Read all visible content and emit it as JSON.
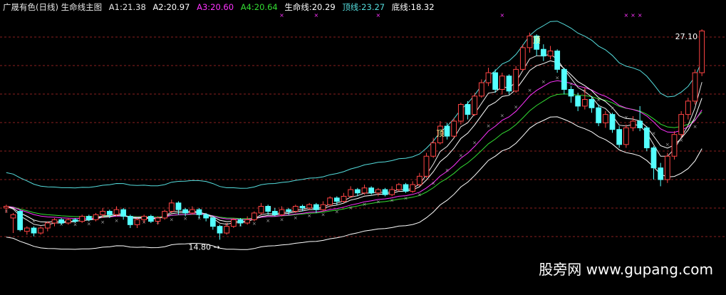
{
  "header": {
    "title": "广晟有色(日线) 生命线主图",
    "items": [
      {
        "label": "A1:21.38",
        "color": "#e6e6e6"
      },
      {
        "label": "A2:20.97",
        "color": "#ffffff"
      },
      {
        "label": "A3:20.60",
        "color": "#ff33ff"
      },
      {
        "label": "A4:20.64",
        "color": "#33dd33"
      },
      {
        "label": "生命线:20.29",
        "color": "#ffffff"
      },
      {
        "label": "顶线:23.27",
        "color": "#55dddd"
      },
      {
        "label": "底线:18.32",
        "color": "#ffffff"
      }
    ]
  },
  "annotations": {
    "high_label": "27.10",
    "low_label": "14.80",
    "top_marker": "顶"
  },
  "watermark": "股旁网 www.gupang.com",
  "chart_data": {
    "type": "candlestick",
    "ylim": [
      12.3,
      28.3
    ],
    "colors": {
      "up": "#ff4444",
      "down": "#54ffff",
      "grid": "#8a1f1f"
    },
    "candles": [
      [
        16.7,
        16.8,
        16.4,
        16.9
      ],
      [
        16.1,
        16.3,
        15.2,
        16.4
      ],
      [
        16.5,
        15.4,
        15.3,
        16.6
      ],
      [
        15.3,
        15.5,
        15.1,
        15.6
      ],
      [
        15.5,
        15.2,
        15.0,
        15.6
      ],
      [
        15.2,
        15.5,
        15.1,
        15.6
      ],
      [
        15.5,
        15.8,
        15.3,
        15.9
      ],
      [
        15.8,
        16.0,
        15.6,
        16.1
      ],
      [
        16.0,
        15.8,
        15.7,
        16.1
      ],
      [
        15.8,
        16.0,
        15.7,
        16.1
      ],
      [
        16.0,
        15.9,
        15.8,
        16.1
      ],
      [
        15.9,
        16.2,
        15.8,
        16.3
      ],
      [
        16.2,
        16.0,
        15.9,
        16.3
      ],
      [
        16.0,
        16.3,
        15.9,
        16.4
      ],
      [
        16.3,
        16.5,
        16.1,
        16.7
      ],
      [
        16.5,
        16.3,
        16.1,
        16.6
      ],
      [
        16.3,
        16.6,
        16.2,
        16.8
      ],
      [
        16.6,
        16.2,
        16.0,
        16.7
      ],
      [
        16.2,
        15.7,
        15.5,
        16.3
      ],
      [
        15.7,
        16.0,
        15.5,
        16.1
      ],
      [
        16.0,
        16.2,
        15.8,
        16.3
      ],
      [
        16.2,
        15.9,
        15.8,
        16.3
      ],
      [
        15.9,
        16.1,
        15.7,
        16.2
      ],
      [
        16.1,
        16.5,
        16.0,
        16.6
      ],
      [
        16.5,
        17.0,
        16.4,
        17.2
      ],
      [
        17.0,
        16.6,
        16.3,
        17.1
      ],
      [
        16.6,
        16.4,
        16.2,
        16.7
      ],
      [
        16.4,
        16.6,
        16.3,
        16.8
      ],
      [
        16.6,
        16.3,
        16.1,
        16.7
      ],
      [
        16.3,
        16.1,
        15.9,
        16.4
      ],
      [
        16.1,
        15.6,
        15.4,
        16.2
      ],
      [
        15.6,
        15.2,
        14.8,
        15.7
      ],
      [
        15.2,
        15.6,
        15.1,
        15.8
      ],
      [
        15.6,
        16.0,
        15.5,
        16.1
      ],
      [
        16.0,
        15.8,
        15.6,
        16.1
      ],
      [
        15.8,
        16.0,
        15.7,
        16.2
      ],
      [
        16.0,
        16.4,
        15.9,
        16.5
      ],
      [
        16.4,
        16.8,
        16.3,
        17.0
      ],
      [
        16.8,
        16.5,
        16.3,
        16.9
      ],
      [
        16.5,
        16.3,
        16.2,
        16.7
      ],
      [
        16.3,
        16.6,
        16.2,
        16.8
      ],
      [
        16.6,
        16.5,
        16.3,
        16.7
      ],
      [
        16.5,
        16.8,
        16.4,
        16.9
      ],
      [
        16.8,
        16.7,
        16.5,
        16.9
      ],
      [
        16.7,
        16.9,
        16.6,
        17.0
      ],
      [
        16.9,
        16.6,
        16.4,
        17.0
      ],
      [
        16.6,
        16.9,
        16.5,
        17.1
      ],
      [
        16.9,
        17.3,
        16.8,
        17.4
      ],
      [
        17.3,
        17.1,
        16.9,
        17.4
      ],
      [
        17.1,
        17.4,
        17.0,
        17.6
      ],
      [
        17.4,
        17.8,
        17.3,
        18.0
      ],
      [
        17.8,
        17.6,
        17.4,
        17.9
      ],
      [
        17.6,
        17.9,
        17.5,
        18.1
      ],
      [
        17.9,
        17.6,
        17.5,
        18.0
      ],
      [
        17.6,
        17.8,
        17.4,
        17.9
      ],
      [
        17.8,
        17.5,
        17.4,
        17.9
      ],
      [
        17.5,
        17.8,
        17.4,
        18.0
      ],
      [
        17.8,
        18.1,
        17.7,
        18.2
      ],
      [
        18.1,
        17.7,
        17.6,
        18.2
      ],
      [
        17.7,
        18.1,
        17.6,
        18.3
      ],
      [
        18.1,
        18.6,
        18.0,
        18.8
      ],
      [
        18.6,
        19.8,
        18.5,
        20.0
      ],
      [
        19.8,
        20.6,
        19.7,
        20.9
      ],
      [
        20.6,
        21.6,
        20.5,
        21.9
      ],
      [
        21.6,
        21.0,
        20.8,
        21.8
      ],
      [
        21.0,
        21.9,
        20.9,
        22.1
      ],
      [
        21.9,
        22.9,
        21.7,
        23.0
      ],
      [
        22.9,
        22.3,
        22.0,
        23.1
      ],
      [
        22.3,
        23.4,
        22.2,
        23.6
      ],
      [
        23.4,
        24.2,
        23.3,
        24.4
      ],
      [
        24.2,
        24.8,
        24.0,
        25.1
      ],
      [
        24.8,
        23.8,
        23.6,
        25.0
      ],
      [
        23.8,
        24.6,
        23.5,
        24.8
      ],
      [
        24.6,
        23.7,
        23.5,
        24.7
      ],
      [
        23.7,
        25.0,
        23.6,
        25.2
      ],
      [
        25.0,
        26.3,
        24.9,
        26.5
      ],
      [
        26.3,
        27.0,
        26.0,
        27.2
      ],
      [
        27.0,
        26.2,
        25.8,
        27.1
      ],
      [
        26.2,
        25.8,
        25.5,
        26.5
      ],
      [
        25.8,
        26.1,
        25.6,
        26.4
      ],
      [
        26.1,
        25.0,
        24.8,
        26.2
      ],
      [
        25.0,
        23.8,
        23.5,
        25.1
      ],
      [
        23.8,
        23.4,
        23.0,
        24.0
      ],
      [
        23.4,
        22.8,
        22.5,
        23.6
      ],
      [
        22.8,
        23.2,
        22.6,
        23.9
      ],
      [
        23.2,
        22.7,
        22.4,
        23.4
      ],
      [
        22.7,
        21.8,
        21.6,
        22.9
      ],
      [
        21.8,
        22.3,
        21.5,
        22.5
      ],
      [
        22.3,
        21.4,
        21.2,
        22.4
      ],
      [
        21.4,
        20.5,
        20.3,
        21.6
      ],
      [
        20.5,
        21.5,
        20.3,
        21.7
      ],
      [
        21.5,
        21.9,
        21.3,
        22.2
      ],
      [
        21.9,
        21.5,
        21.3,
        22.8
      ],
      [
        21.5,
        20.3,
        20.1,
        21.6
      ],
      [
        20.3,
        19.1,
        18.4,
        20.4
      ],
      [
        19.1,
        18.4,
        18.0,
        19.4
      ],
      [
        18.4,
        19.8,
        18.2,
        20.0
      ],
      [
        19.8,
        21.1,
        19.6,
        21.3
      ],
      [
        21.1,
        22.3,
        20.9,
        22.5
      ],
      [
        22.3,
        23.1,
        22.0,
        23.3
      ],
      [
        23.1,
        24.8,
        22.9,
        25.0
      ],
      [
        24.8,
        27.3,
        24.6,
        27.4
      ]
    ]
  }
}
